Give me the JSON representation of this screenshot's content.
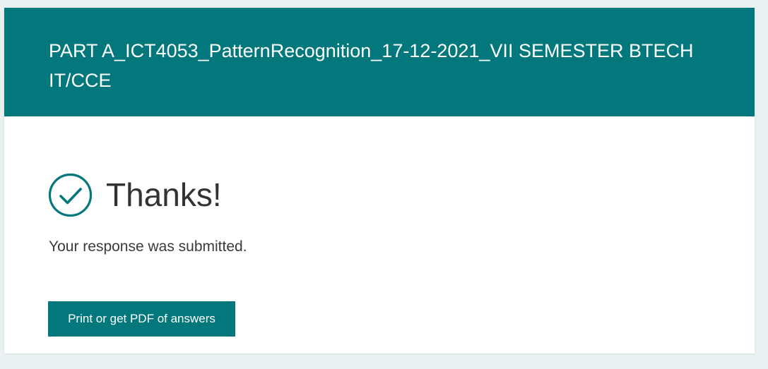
{
  "form": {
    "title": "PART A_ICT4053_PatternRecognition_17-12-2021_VII SEMESTER BTECH IT/CCE"
  },
  "confirmation": {
    "icon": "check-circle-icon",
    "heading": "Thanks!",
    "message": "Your response was submitted.",
    "print_button_label": "Print or get PDF of answers"
  },
  "colors": {
    "accent": "#03787c",
    "background": "#e9f1f3",
    "card": "#ffffff",
    "text": "#333333"
  }
}
